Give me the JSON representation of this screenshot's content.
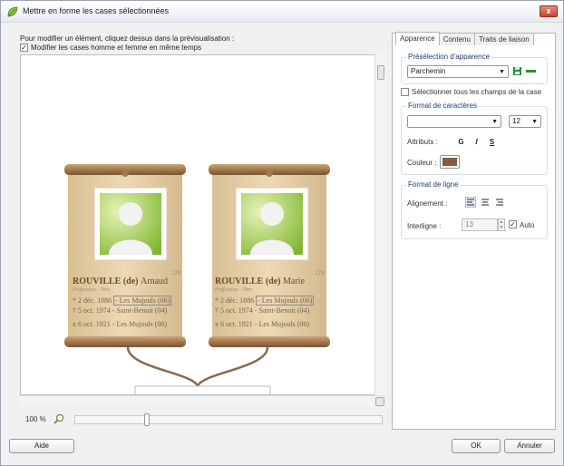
{
  "window": {
    "title": "Mettre en forme les cases sélectionnées",
    "close": "x"
  },
  "instruction": "Pour modifier un élément, cliquez dessus dans la prévisualisation :",
  "sync_checkbox": {
    "label": "Modifier les cases homme et femme en même temps",
    "checked": true
  },
  "cards": [
    {
      "number": "128",
      "surname": "ROUVILLE (de)",
      "firstname": "Arnaud",
      "subtitle": "Profession - Titre",
      "birth_date": "* 2 déc. 1886",
      "birth_place": "- Les Mujouls (06)",
      "death": "† 5 oct. 1974 - Saint-Benoit (04)",
      "marriage": "x 6 oct. 1921 - Les Mujouls (06)"
    },
    {
      "number": "129",
      "surname": "ROUVILLE (de)",
      "firstname": "Marie",
      "subtitle": "Profession - Titre",
      "birth_date": "* 2 déc. 1886",
      "birth_place": "- Les Mujouls (06)",
      "death": "† 5 oct. 1974 - Saint-Benoit (04)",
      "marriage": "x 6 oct. 1921 - Les Mujouls (06)"
    }
  ],
  "zoom": {
    "label": "100 %",
    "level": 0.23
  },
  "tabs": [
    "Apparence",
    "Contenu",
    "Traits de liaison"
  ],
  "preset": {
    "group_label": "Présélection d'apparence",
    "value": "Parchemin"
  },
  "select_all": {
    "label": "Sélectionner tous les champs de la case",
    "checked": false
  },
  "char_format": {
    "group_label": "Format de caractères",
    "font": "",
    "size": "12",
    "attributes_label": "Attributs :",
    "bold": "G",
    "italic": "I",
    "underline": "S",
    "color_label": "Couleur :",
    "color": "#8a5a3c"
  },
  "line_format": {
    "group_label": "Format de ligne",
    "align_label": "Alignement :",
    "spacing_label": "Interligne :",
    "spacing_value": "13",
    "auto_label": "Auto",
    "auto_checked": true
  },
  "buttons": {
    "help": "Aide",
    "ok": "OK",
    "cancel": "Annuler"
  },
  "colors": {
    "parchment": "#e7d3ac",
    "parchment_dark": "#b8946a",
    "ink": "#6a4b2f",
    "accent_green": "#2e8b3a"
  }
}
